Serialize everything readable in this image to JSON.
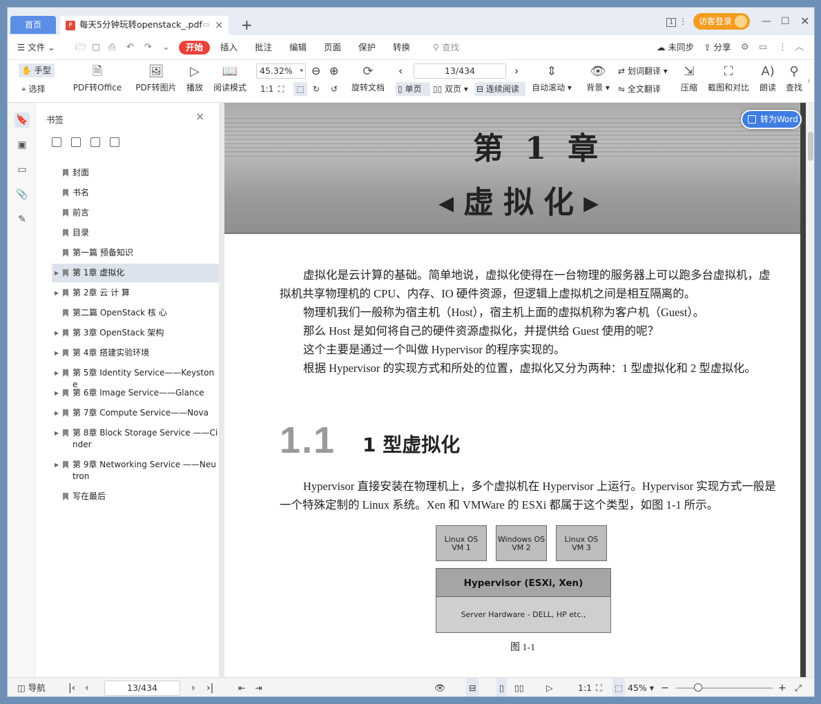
{
  "window": {
    "home_tab": "首页",
    "doc_tab": "每天5分钟玩转openstack_.pdf",
    "new_tab": "+",
    "page_badge": "1",
    "guest_login": "访客登录"
  },
  "menu": {
    "file": "文件",
    "start": "开始",
    "items": [
      "插入",
      "批注",
      "编辑",
      "页面",
      "保护",
      "转换"
    ],
    "search": "查找",
    "sync": "未同步",
    "share": "分享"
  },
  "toolbar": {
    "hand": "手型",
    "select": "选择",
    "pdf_to_office": "PDF转Office",
    "pdf_to_image": "PDF转图片",
    "play": "播放",
    "read_mode": "阅读模式",
    "zoom": "45.32%",
    "rotate_doc": "旋转文档",
    "page_input": "13/434",
    "single_page": "单页",
    "double_page": "双页",
    "continuous": "连续阅读",
    "auto_scroll": "自动滚动",
    "background": "背景",
    "word_translate": "划词翻译",
    "full_translate": "全文翻译",
    "compress": "压缩",
    "screenshot_compare": "截图和对比",
    "read_aloud": "朗读",
    "find": "查找"
  },
  "bookmarks": {
    "title": "书签",
    "items": [
      {
        "label": "封面",
        "expandable": false
      },
      {
        "label": "书名",
        "expandable": false
      },
      {
        "label": "前言",
        "expandable": false
      },
      {
        "label": "目录",
        "expandable": false
      },
      {
        "label": "第一篇 预备知识",
        "expandable": false
      },
      {
        "label": "第 1章 虚拟化",
        "expandable": true,
        "selected": true
      },
      {
        "label": "第 2章 云 计 算",
        "expandable": true
      },
      {
        "label": "第二篇 OpenStack 核 心",
        "expandable": false
      },
      {
        "label": "第 3章 OpenStack 架构",
        "expandable": true
      },
      {
        "label": "第 4章 搭建实验环境",
        "expandable": true
      },
      {
        "label": "第 5章 Identity Service——Keystone",
        "expandable": true
      },
      {
        "label": "第 6章 Image Service——Glance",
        "expandable": true
      },
      {
        "label": "第 7章 Compute Service——Nova",
        "expandable": true
      },
      {
        "label": "第 8章 Block Storage Service ——Cinder",
        "expandable": true
      },
      {
        "label": "第 9章 Networking Service ——Neutron",
        "expandable": true
      },
      {
        "label": "写在最后",
        "expandable": false
      }
    ]
  },
  "document": {
    "to_word": "转为Word",
    "chapter_no": "第 1 章",
    "chapter_name": "◂虚拟化▸",
    "paragraphs": [
      "虚拟化是云计算的基础。简单地说，虚拟化使得在一台物理的服务器上可以跑多台虚拟机，虚拟机共享物理机的 CPU、内存、IO 硬件资源，但逻辑上虚拟机之间是相互隔离的。",
      "物理机我们一般称为宿主机（Host），宿主机上面的虚拟机称为客户机（Guest）。",
      "那么 Host 是如何将自己的硬件资源虚拟化，并提供给 Guest 使用的呢？",
      "这个主要是通过一个叫做 Hypervisor 的程序实现的。",
      "根据 Hypervisor 的实现方式和所处的位置，虚拟化又分为两种：1 型虚拟化和 2 型虚拟化。"
    ],
    "section_no": "1.1",
    "section_title": "1 型虚拟化",
    "section_para": "Hypervisor 直接安装在物理机上，多个虚拟机在 Hypervisor 上运行。Hypervisor 实现方式一般是一个特殊定制的 Linux 系统。Xen 和 VMWare 的 ESXi 都属于这个类型，如图 1-1 所示。",
    "figure": {
      "vms": [
        "Linux OS\nVM 1",
        "Windows OS\nVM 2",
        "Linux OS\nVM 3"
      ],
      "hypervisor": "Hypervisor (ESXi, Xen)",
      "hardware": "Server Hardware - DELL, HP etc.,",
      "caption": "图 1-1"
    }
  },
  "status": {
    "nav": "导航",
    "page": "13/434",
    "zoom": "45%"
  }
}
